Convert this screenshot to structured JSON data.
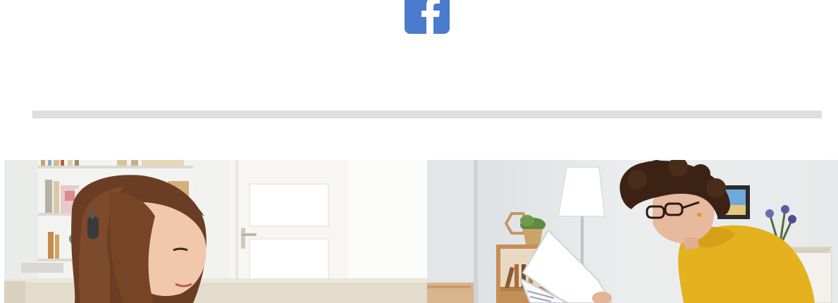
{
  "social": {
    "facebook_icon": "facebook-icon",
    "facebook_color": "#4a7bcc"
  },
  "divider": {
    "color": "#dedede"
  },
  "featured": {
    "items": [
      {
        "image_icon": "woman-with-headphones-photo"
      },
      {
        "image_icon": "woman-reading-document-photo"
      }
    ]
  }
}
